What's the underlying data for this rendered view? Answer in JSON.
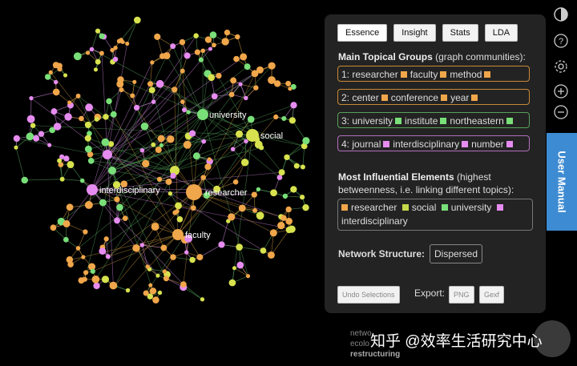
{
  "graph": {
    "labels": {
      "university": "university",
      "social": "social",
      "interdisciplinary": "interdisciplinary",
      "researcher": "researcher",
      "faculty": "faculty"
    },
    "colors": {
      "orange": "#f0a64a",
      "yellow": "#d7e24e",
      "green": "#79df79",
      "pink": "#e68cf0",
      "edge_green": "#4f9a55",
      "edge_orange": "#b78a3a",
      "edge_pink": "#c27ccf"
    }
  },
  "panel": {
    "tabs": [
      "Essence",
      "Insight",
      "Stats",
      "LDA"
    ],
    "main_groups_title": "Main Topical Groups",
    "main_groups_sub": "(graph communities):",
    "groups": [
      {
        "prefix": "1:",
        "words": [
          "researcher",
          "faculty",
          "method"
        ],
        "color": "#f0a64a",
        "border": "#c98a35"
      },
      {
        "prefix": "2:",
        "words": [
          "center",
          "conference",
          "year"
        ],
        "color": "#f0a64a",
        "border": "#c98a35"
      },
      {
        "prefix": "3:",
        "words": [
          "university",
          "institute",
          "northeastern"
        ],
        "color": "#79df79",
        "border": "#5aa05a"
      },
      {
        "prefix": "4:",
        "words": [
          "journal",
          "interdisciplinary",
          "number"
        ],
        "color": "#e68cf0",
        "border": "#b56ec0"
      }
    ],
    "influential_title": "Most Influential Elements",
    "influential_sub1": "(highest",
    "influential_sub2": "betweenness, i.e. linking different topics):",
    "influential": [
      {
        "word": "researcher",
        "color": "#f0a64a"
      },
      {
        "word": "social",
        "color": "#c4d84a"
      },
      {
        "word": "university",
        "color": "#79df79"
      },
      {
        "word": "interdisciplinary",
        "color": "#e68cf0"
      }
    ],
    "network_structure_label": "Network Structure:",
    "network_structure_value": "Dispersed",
    "undo_label": "Undo Selections",
    "export_label": "Export:",
    "png_label": "PNG",
    "gexf_label": "Gexf"
  },
  "user_manual_label": "User Manual",
  "bottom": {
    "line1": "netwo",
    "line2": "ecolo",
    "line3": "restructuring"
  },
  "watermark": "知乎 @效率生活研究中心"
}
